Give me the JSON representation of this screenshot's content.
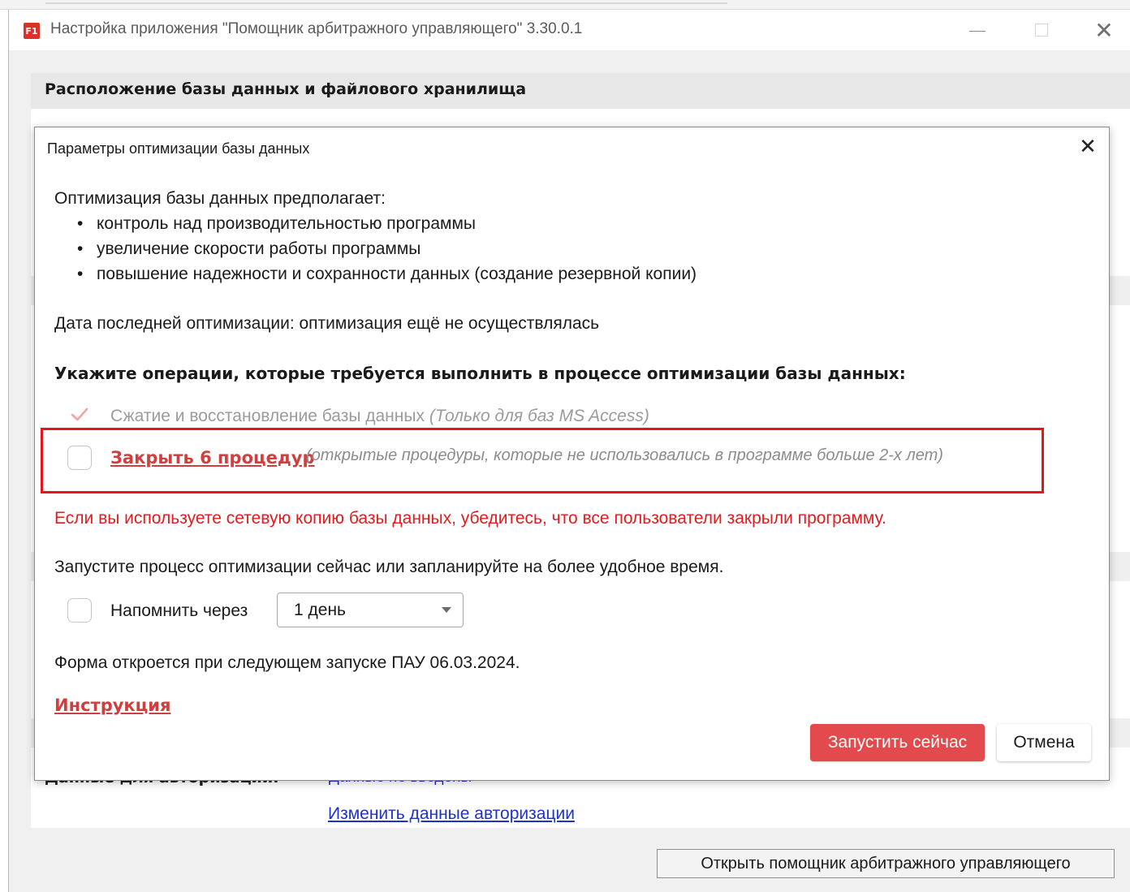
{
  "window": {
    "app_icon_text": "F1",
    "title": "Настройка приложения \"Помощник арбитражного управляющего\" 3.30.0.1"
  },
  "panel": {
    "title": "Расположение базы данных и файлового хранилища",
    "auth_label": "Данные для авторизации:",
    "auth_value": "Данные не введены",
    "auth_change_link": "Изменить данные авторизации",
    "open_button": "Открыть помощник арбитражного управляющего"
  },
  "dialog": {
    "title": "Параметры оптимизации базы данных",
    "intro": "Оптимизация базы данных предполагает:",
    "bullets": [
      "контроль над производительностью программы",
      "увеличение скорости работы программы",
      "повышение надежности и сохранности данных (создание резервной копии)"
    ],
    "last_date": "Дата последней оптимизации: оптимизация ещё не осуществлялась",
    "operations_heading": "Укажите операции, которые требуется выполнить в процессе оптимизации базы данных:",
    "option_compress": {
      "label": "Сжатие и восстановление базы данных",
      "note": "(Только для баз MS Access)",
      "checked": true,
      "disabled": true
    },
    "option_close": {
      "link": "Закрыть 6 процедур",
      "note": "(открытые процедуры, которые не использовались в программе больше 2-х лет)",
      "checked": false
    },
    "warning": "Если вы используете сетевую копию базы данных, убедитесь, что все пользователи закрыли программу.",
    "schedule_text": "Запустите процесс оптимизации сейчас или запланируйте на более удобное время.",
    "remind": {
      "label": "Напомнить через",
      "checked": false,
      "selected": "1 день"
    },
    "next_open": "Форма откроется при следующем запуске ПАУ 06.03.2024.",
    "instruction_link": "Инструкция",
    "run_button": "Запустить сейчас",
    "cancel_button": "Отмена"
  },
  "colors": {
    "accent_red": "#e24a4d",
    "link_red": "#cf3f3f",
    "warning_red": "#e21c1c",
    "highlight_border": "#e8141b",
    "link_blue": "#1f33c9"
  },
  "icons": {
    "app": "app-logo-icon",
    "minimize": "minimize-icon",
    "maximize": "maximize-icon",
    "close": "close-icon",
    "check": "checkmark-icon",
    "dropdown": "chevron-down-icon"
  }
}
